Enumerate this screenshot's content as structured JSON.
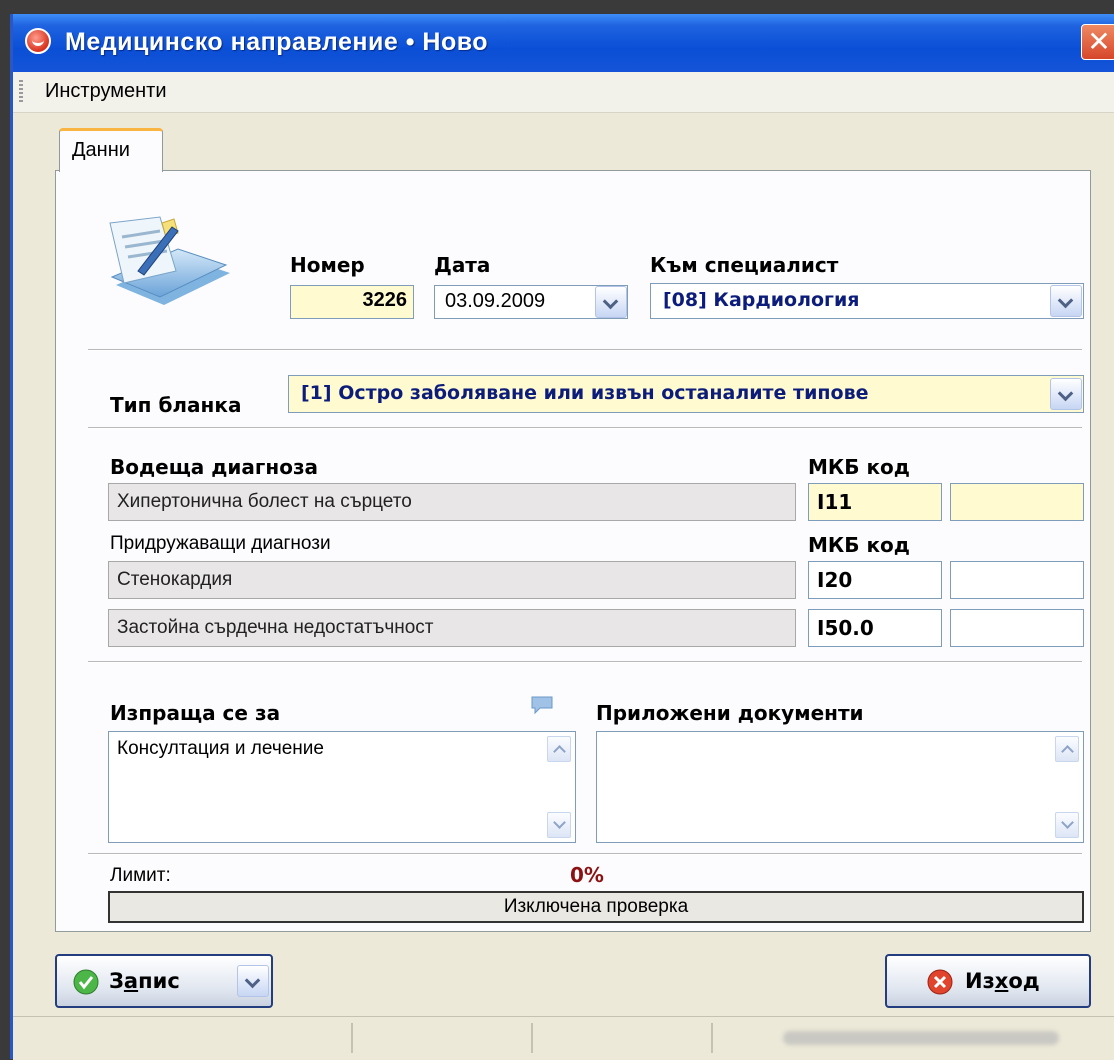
{
  "window": {
    "title": "Медицинско направление • Ново",
    "close_label": "✕"
  },
  "menu": {
    "tools": "Инструменти"
  },
  "tab": {
    "label": "Данни"
  },
  "form": {
    "number_label": "Номер",
    "number_value": "3226",
    "date_label": "Дата",
    "date_value": "03.09.2009",
    "specialist_label": "Към специалист",
    "specialist_value": "[08] Кардиология",
    "form_type_label": "Тип бланка",
    "form_type_value": "[1] Остро заболяване или извън останалите типове",
    "main_diag_label": "Водеща диагноза",
    "mkb_label": "МКБ код",
    "main_diag_value": "Хипертонична болест на сърцето",
    "main_diag_code": "I11",
    "main_diag_code2": "",
    "accomp_label": "Придружаващи диагнози",
    "accomp_mkb_label": "МКБ код",
    "accomp": [
      {
        "name": "Стенокардия",
        "code": "I20",
        "code2": ""
      },
      {
        "name": "Застойна сърдечна недостатъчност",
        "code": "I50.0",
        "code2": ""
      }
    ],
    "sent_for_label": "Изпраща се за",
    "sent_for_value": "Консултация и лечение",
    "attached_label": "Приложени документи",
    "attached_value": "",
    "limit_label": "Лимит:",
    "limit_percent": "0%",
    "limit_progress": 0,
    "check_status": "Изключена проверка"
  },
  "buttons": {
    "save_prefix": "З",
    "save_underlined": "а",
    "save_suffix": "пис",
    "exit_prefix": "Из",
    "exit_underlined": "х",
    "exit_suffix": "од"
  },
  "colors": {
    "title_blue": "#0a4fd6",
    "value_navy": "#0b1c7a",
    "limit_red": "#8a1212",
    "yellow_field": "#fffad0"
  }
}
